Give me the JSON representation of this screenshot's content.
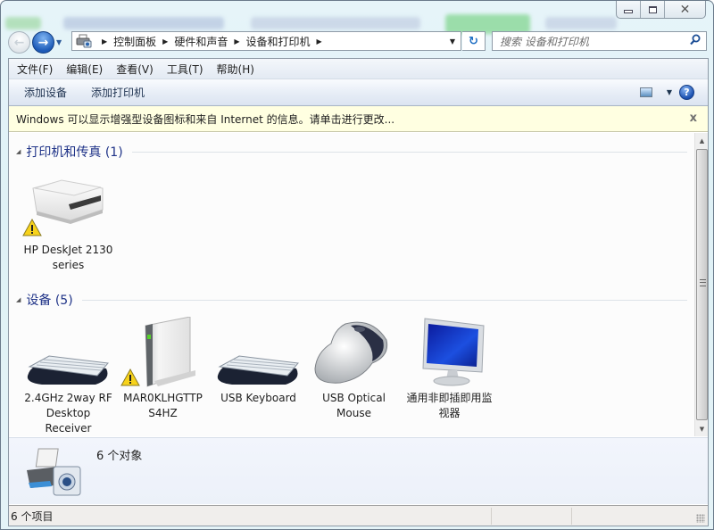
{
  "window": {
    "controls": {
      "minimize": "minimize",
      "maximize": "maximize",
      "close": "close"
    }
  },
  "navigation": {
    "back_icon": "back-arrow",
    "forward_icon": "forward-arrow",
    "recent_dropdown_icon": "chevron-down"
  },
  "address": {
    "icon": "devices-printers-icon",
    "breadcrumbs": [
      "控制面板",
      "硬件和声音",
      "设备和打印机"
    ],
    "separator": "▶",
    "dropdown": "▼",
    "refresh_icon": "↻"
  },
  "search": {
    "placeholder": "搜索 设备和打印机",
    "icon": "search"
  },
  "menubar": {
    "items": [
      "文件(F)",
      "编辑(E)",
      "查看(V)",
      "工具(T)",
      "帮助(H)"
    ]
  },
  "commandbar": {
    "items": [
      "添加设备",
      "添加打印机"
    ],
    "view_icon": "change-view",
    "view_dropdown": "▼",
    "help": "?"
  },
  "infobar": {
    "text": "Windows 可以显示增强型设备图标和来自 Internet 的信息。请单击进行更改...",
    "close": "x"
  },
  "groups": [
    {
      "title": "打印机和传真 (1)",
      "items": [
        {
          "label": "HP DeskJet 2130 series",
          "icon": "printer",
          "warning": true
        }
      ]
    },
    {
      "title": "设备 (5)",
      "items": [
        {
          "label": "2.4GHz 2way RF Desktop Receiver",
          "icon": "keyboard",
          "warning": false
        },
        {
          "label": "MAR0KLHGTTP S4HZ",
          "icon": "external-drive",
          "warning": true
        },
        {
          "label": "USB Keyboard",
          "icon": "keyboard",
          "warning": false
        },
        {
          "label": "USB Optical Mouse",
          "icon": "mouse",
          "warning": false
        },
        {
          "label": "通用非即插即用监视器",
          "icon": "monitor",
          "warning": false
        }
      ]
    }
  ],
  "details": {
    "text": "6 个对象",
    "icon": "devices-printers-large"
  },
  "statusbar": {
    "text": "6 个项目"
  },
  "colors": {
    "group_heading": "#1e3287",
    "infobar_bg": "#ffffe1",
    "details_bg": "#eef2fa"
  }
}
